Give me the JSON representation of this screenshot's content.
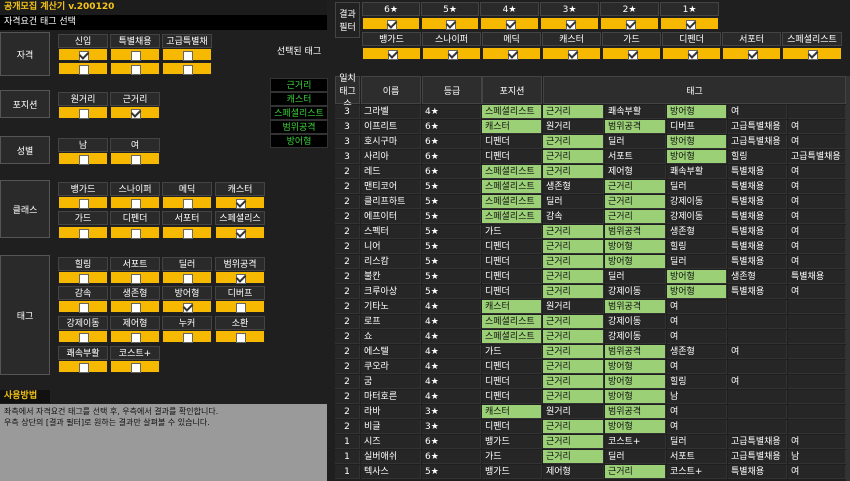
{
  "app": {
    "title": "공개모집 계산기 v.200120",
    "subtitle": "자격요건 태그 선택"
  },
  "categories": [
    {
      "label": "자격",
      "rows": [
        {
          "cols": [
            "신입",
            "특별채용",
            "고급특별채용"
          ],
          "checked": [
            true,
            false,
            false
          ]
        },
        {
          "cols": [
            "",
            "",
            ""
          ],
          "checked": [
            false,
            false,
            false
          ]
        }
      ]
    },
    {
      "label": "포지션",
      "rows": [
        {
          "cols": [
            "원거리",
            "근거리"
          ],
          "checked": [
            false,
            true
          ]
        }
      ]
    },
    {
      "label": "성별",
      "rows": [
        {
          "cols": [
            "남",
            "여"
          ],
          "checked": [
            false,
            false
          ]
        }
      ]
    },
    {
      "label": "클래스",
      "rows": [
        {
          "cols": [
            "뱅가드",
            "스나이퍼",
            "메딕",
            "캐스터"
          ],
          "checked": [
            false,
            false,
            false,
            true
          ]
        },
        {
          "cols": [
            "가드",
            "디펜더",
            "서포터",
            "스페셜리스트"
          ],
          "checked": [
            false,
            false,
            false,
            true
          ]
        }
      ]
    },
    {
      "label": "태그",
      "rows": [
        {
          "cols": [
            "힐링",
            "서포트",
            "딜러",
            "범위공격"
          ],
          "checked": [
            false,
            false,
            false,
            true
          ]
        },
        {
          "cols": [
            "감속",
            "생존형",
            "방어형",
            "디버프"
          ],
          "checked": [
            false,
            false,
            true,
            false
          ]
        },
        {
          "cols": [
            "강제이동",
            "제어형",
            "누커",
            "소환"
          ],
          "checked": [
            false,
            false,
            false,
            false
          ]
        },
        {
          "cols": [
            "쾌속부활",
            "코스트+"
          ],
          "checked": [
            false,
            false
          ]
        }
      ]
    }
  ],
  "selected_tags": {
    "title": "선택된 태그",
    "tags": [
      "근거리",
      "캐스터",
      "스페셜리스트",
      "범위공격",
      "방어형"
    ]
  },
  "usage": {
    "heading": "사용방법",
    "lines": [
      "좌측에서 자격요건 태그를 선택 후, 우측에서 결과를 확인합니다.",
      "우측 상단의 [결과 필터]로 원하는 결과만 살펴볼 수 있습니다."
    ]
  },
  "filter": {
    "label": "결과 필터",
    "stars": [
      "6★",
      "5★",
      "4★",
      "3★",
      "2★",
      "1★"
    ],
    "stars_checked": [
      true,
      true,
      true,
      true,
      true,
      true
    ],
    "classes": [
      "뱅가드",
      "스나이퍼",
      "메딕",
      "캐스터",
      "가드",
      "디펜더",
      "서포터",
      "스페셜리스트"
    ],
    "classes_checked": [
      true,
      true,
      true,
      true,
      true,
      true,
      true,
      true
    ]
  },
  "results": {
    "headers": {
      "count": "일치 태그수",
      "name": "이름",
      "grade": "등급",
      "position": "포지션",
      "tags": "태그"
    },
    "rows": [
      {
        "n": "3",
        "name": "그라벨",
        "g": "4★",
        "c": [
          "스페셜리스트",
          "근거리",
          "쾌속부활",
          "방어형",
          "여",
          ""
        ],
        "hl": [
          1,
          1,
          0,
          1,
          0,
          0
        ]
      },
      {
        "n": "3",
        "name": "이프리트",
        "g": "6★",
        "c": [
          "캐스터",
          "원거리",
          "범위공격",
          "디버프",
          "고급특별채용",
          "여"
        ],
        "hl": [
          1,
          0,
          1,
          0,
          0,
          0
        ]
      },
      {
        "n": "3",
        "name": "호시구마",
        "g": "6★",
        "c": [
          "디펜더",
          "근거리",
          "딜러",
          "방어형",
          "고급특별채용",
          "여"
        ],
        "hl": [
          0,
          1,
          0,
          1,
          0,
          0
        ]
      },
      {
        "n": "3",
        "name": "사리아",
        "g": "6★",
        "c": [
          "디펜더",
          "근거리",
          "서포트",
          "방어형",
          "힐링",
          "고급특별채용"
        ],
        "hl": [
          0,
          1,
          0,
          1,
          0,
          0
        ]
      },
      {
        "n": "2",
        "name": "레드",
        "g": "6★",
        "c": [
          "스페셜리스트",
          "근거리",
          "제어형",
          "쾌속부활",
          "특별채용",
          "여"
        ],
        "hl": [
          1,
          1,
          0,
          0,
          0,
          0
        ]
      },
      {
        "n": "2",
        "name": "맨티코어",
        "g": "5★",
        "c": [
          "스페셜리스트",
          "생존형",
          "근거리",
          "딜러",
          "특별채용",
          "여"
        ],
        "hl": [
          1,
          0,
          1,
          0,
          0,
          0
        ]
      },
      {
        "n": "2",
        "name": "클리프하트",
        "g": "5★",
        "c": [
          "스페셜리스트",
          "딜러",
          "근거리",
          "강제이동",
          "특별채용",
          "여"
        ],
        "hl": [
          1,
          0,
          1,
          0,
          0,
          0
        ]
      },
      {
        "n": "2",
        "name": "에프이터",
        "g": "5★",
        "c": [
          "스페셜리스트",
          "감속",
          "근거리",
          "강제이동",
          "특별채용",
          "여"
        ],
        "hl": [
          1,
          0,
          1,
          0,
          0,
          0
        ]
      },
      {
        "n": "2",
        "name": "스펙터",
        "g": "5★",
        "c": [
          "가드",
          "근거리",
          "범위공격",
          "생존형",
          "특별채용",
          "여"
        ],
        "hl": [
          0,
          1,
          1,
          0,
          0,
          0
        ]
      },
      {
        "n": "2",
        "name": "니어",
        "g": "5★",
        "c": [
          "디펜더",
          "근거리",
          "방어형",
          "힐링",
          "특별채용",
          "여"
        ],
        "hl": [
          0,
          1,
          1,
          0,
          0,
          0
        ]
      },
      {
        "n": "2",
        "name": "리스캄",
        "g": "5★",
        "c": [
          "디펜더",
          "근거리",
          "방어형",
          "딜러",
          "특별채용",
          "여"
        ],
        "hl": [
          0,
          1,
          1,
          0,
          0,
          0
        ]
      },
      {
        "n": "2",
        "name": "불칸",
        "g": "5★",
        "c": [
          "디펜더",
          "근거리",
          "딜러",
          "방어형",
          "생존형",
          "특별채용"
        ],
        "hl": [
          0,
          1,
          0,
          1,
          0,
          0
        ]
      },
      {
        "n": "2",
        "name": "크루아상",
        "g": "5★",
        "c": [
          "디펜더",
          "근거리",
          "강제이동",
          "방어형",
          "특별채용",
          "여"
        ],
        "hl": [
          0,
          1,
          0,
          1,
          0,
          0
        ]
      },
      {
        "n": "2",
        "name": "기타노",
        "g": "4★",
        "c": [
          "캐스터",
          "원거리",
          "범위공격",
          "여",
          "",
          ""
        ],
        "hl": [
          1,
          0,
          1,
          0,
          0,
          0
        ]
      },
      {
        "n": "2",
        "name": "로프",
        "g": "4★",
        "c": [
          "스페셜리스트",
          "근거리",
          "강제이동",
          "여",
          "",
          ""
        ],
        "hl": [
          1,
          1,
          0,
          0,
          0,
          0
        ]
      },
      {
        "n": "2",
        "name": "쇼",
        "g": "4★",
        "c": [
          "스페셜리스트",
          "근거리",
          "강제이동",
          "여",
          "",
          ""
        ],
        "hl": [
          1,
          1,
          0,
          0,
          0,
          0
        ]
      },
      {
        "n": "2",
        "name": "에스텔",
        "g": "4★",
        "c": [
          "가드",
          "근거리",
          "범위공격",
          "생존형",
          "여",
          ""
        ],
        "hl": [
          0,
          1,
          1,
          0,
          0,
          0
        ]
      },
      {
        "n": "2",
        "name": "쿠오라",
        "g": "4★",
        "c": [
          "디펜더",
          "근거리",
          "방어형",
          "여",
          "",
          ""
        ],
        "hl": [
          0,
          1,
          1,
          0,
          0,
          0
        ]
      },
      {
        "n": "2",
        "name": "굼",
        "g": "4★",
        "c": [
          "디펜더",
          "근거리",
          "방어형",
          "힐링",
          "여",
          ""
        ],
        "hl": [
          0,
          1,
          1,
          0,
          0,
          0
        ]
      },
      {
        "n": "2",
        "name": "마터호른",
        "g": "4★",
        "c": [
          "디펜더",
          "근거리",
          "방어형",
          "남",
          "",
          ""
        ],
        "hl": [
          0,
          1,
          1,
          0,
          0,
          0
        ]
      },
      {
        "n": "2",
        "name": "라바",
        "g": "3★",
        "c": [
          "캐스터",
          "원거리",
          "범위공격",
          "여",
          "",
          ""
        ],
        "hl": [
          1,
          0,
          1,
          0,
          0,
          0
        ]
      },
      {
        "n": "2",
        "name": "비글",
        "g": "3★",
        "c": [
          "디펜더",
          "근거리",
          "방어형",
          "여",
          "",
          ""
        ],
        "hl": [
          0,
          1,
          1,
          0,
          0,
          0
        ]
      },
      {
        "n": "1",
        "name": "시즈",
        "g": "6★",
        "c": [
          "뱅가드",
          "근거리",
          "코스트+",
          "딜러",
          "고급특별채용",
          "여"
        ],
        "hl": [
          0,
          1,
          0,
          0,
          0,
          0
        ]
      },
      {
        "n": "1",
        "name": "실버애쉬",
        "g": "6★",
        "c": [
          "가드",
          "근거리",
          "딜러",
          "서포트",
          "고급특별채용",
          "남"
        ],
        "hl": [
          0,
          1,
          0,
          0,
          0,
          0
        ]
      },
      {
        "n": "1",
        "name": "텍사스",
        "g": "5★",
        "c": [
          "뱅가드",
          "제어형",
          "근거리",
          "코스트+",
          "특별채용",
          "여"
        ],
        "hl": [
          0,
          0,
          1,
          0,
          0,
          0
        ]
      }
    ]
  }
}
